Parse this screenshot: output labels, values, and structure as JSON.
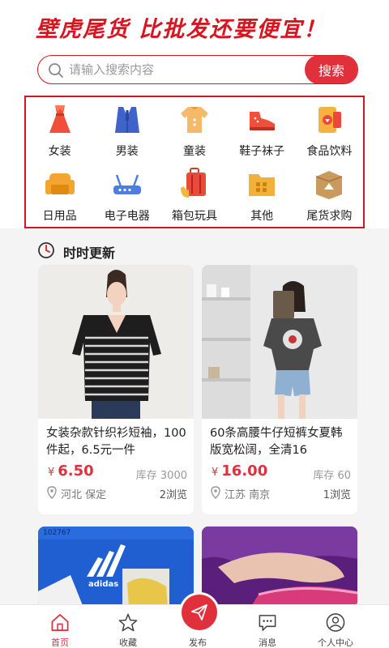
{
  "banner": {
    "title": "壁虎尾货  比批发还要便宜！"
  },
  "search": {
    "placeholder": "请输入搜索内容",
    "button_label": "搜索"
  },
  "categories": [
    {
      "label": "女装",
      "icon": "dress-icon"
    },
    {
      "label": "男装",
      "icon": "suit-icon"
    },
    {
      "label": "童装",
      "icon": "kids-clothes-icon"
    },
    {
      "label": "鞋子袜子",
      "icon": "shoe-icon"
    },
    {
      "label": "食品饮料",
      "icon": "food-icon"
    },
    {
      "label": "日用品",
      "icon": "sofa-icon"
    },
    {
      "label": "电子电器",
      "icon": "router-icon"
    },
    {
      "label": "箱包玩具",
      "icon": "luggage-icon"
    },
    {
      "label": "其他",
      "icon": "folder-icon"
    },
    {
      "label": "尾货求购",
      "icon": "box-icon"
    }
  ],
  "section": {
    "title": "时时更新"
  },
  "products": [
    {
      "title": "女装杂款针织衫短袖，100件起，6.5元一件",
      "currency": "¥",
      "price": "6.50",
      "stock": "库存 3000",
      "location": "河北 保定",
      "views": "2浏览"
    },
    {
      "title": "60条高腰牛仔短裤女夏韩版宽松阔，全清16",
      "currency": "¥",
      "price": "16.00",
      "stock": "库存 60",
      "location": "江苏 南京",
      "views": "1浏览"
    },
    {
      "image_text": "102767",
      "brand_text": "adidas"
    },
    {}
  ],
  "tabbar": {
    "home": "首页",
    "favorites": "收藏",
    "publish": "发布",
    "messages": "消息",
    "profile": "个人中心"
  },
  "colors": {
    "accent": "#e0303c",
    "frame": "#d8141e"
  }
}
